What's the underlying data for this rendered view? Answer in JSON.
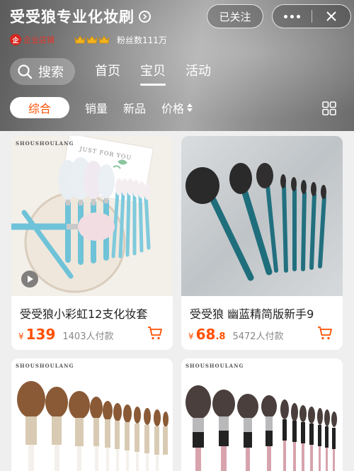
{
  "shop": {
    "name": "受受狼专业化妆刷",
    "follow_label": "已关注",
    "enterprise_label": "企业店铺",
    "enterprise_badge": "企",
    "fans_label": "粉丝数111万",
    "crown_count": 3
  },
  "nav": {
    "search_label": "搜索",
    "tabs": [
      {
        "label": "首页",
        "active": false
      },
      {
        "label": "宝贝",
        "active": true
      },
      {
        "label": "活动",
        "active": false
      }
    ]
  },
  "sort": {
    "items": [
      {
        "label": "综合",
        "active": true
      },
      {
        "label": "销量",
        "active": false
      },
      {
        "label": "新品",
        "active": false
      },
      {
        "label": "价格",
        "active": false
      }
    ]
  },
  "products": [
    {
      "brand": "SHOUSHOULANG",
      "title": "受受狼小彩虹12支化妆套",
      "yen": "¥",
      "price_int": "139",
      "price_dec": "",
      "sold": "1403人付款",
      "has_video": true,
      "card_text": "JUST FOR YOU"
    },
    {
      "brand": "",
      "title": "受受狼 幽蓝精简版新手9",
      "yen": "¥",
      "price_int": "68",
      "price_dec": ".8",
      "sold": "5472人付款",
      "has_video": false
    },
    {
      "brand": "SHOUSHOULANG",
      "title": "",
      "yen": "",
      "price_int": "",
      "price_dec": "",
      "sold": "",
      "has_video": false
    },
    {
      "brand": "SHOUSHOULANG",
      "title": "",
      "yen": "",
      "price_int": "",
      "price_dec": "",
      "sold": "",
      "has_video": false
    }
  ],
  "colors": {
    "accent": "#ff5000",
    "enterprise_red": "#d8261e",
    "crown_gold": "#f2b320"
  }
}
